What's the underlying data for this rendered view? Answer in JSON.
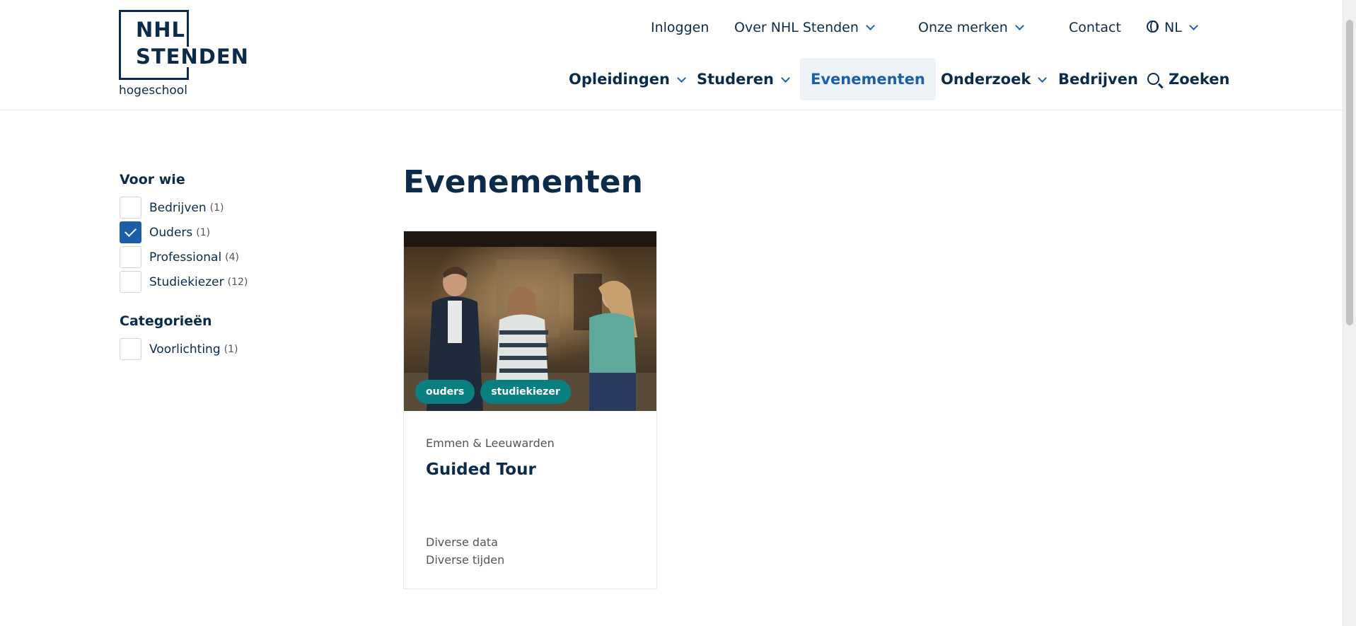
{
  "logo": {
    "line1": "NHL",
    "line2": "STENDEN",
    "sub": "hogeschool"
  },
  "top_nav": {
    "login": "Inloggen",
    "about": "Over NHL Stenden",
    "brands": "Onze merken",
    "contact": "Contact",
    "language": "NL"
  },
  "main_nav": {
    "items": [
      {
        "label": "Opleidingen"
      },
      {
        "label": "Studeren"
      },
      {
        "label": "Evenementen"
      },
      {
        "label": "Onderzoek"
      },
      {
        "label": "Bedrijven"
      }
    ],
    "search": "Zoeken"
  },
  "filters": {
    "audience": {
      "heading": "Voor wie",
      "options": [
        {
          "label": "Bedrijven",
          "count": "(1)",
          "checked": false
        },
        {
          "label": "Ouders",
          "count": "(1)",
          "checked": true
        },
        {
          "label": "Professional",
          "count": "(4)",
          "checked": false
        },
        {
          "label": "Studiekiezer",
          "count": "(12)",
          "checked": false
        }
      ]
    },
    "categories": {
      "heading": "Categorieën",
      "options": [
        {
          "label": "Voorlichting",
          "count": "(1)",
          "checked": false
        }
      ]
    }
  },
  "page": {
    "title": "Evenementen"
  },
  "events": [
    {
      "tags": [
        "ouders",
        "studiekiezer"
      ],
      "location": "Emmen & Leeuwarden",
      "title": "Guided Tour",
      "dates": "Diverse data",
      "times": "Diverse tijden"
    }
  ],
  "colors": {
    "navy": "#0c2b4b",
    "accent": "#1c5fa8",
    "tag": "#0a7f82"
  }
}
